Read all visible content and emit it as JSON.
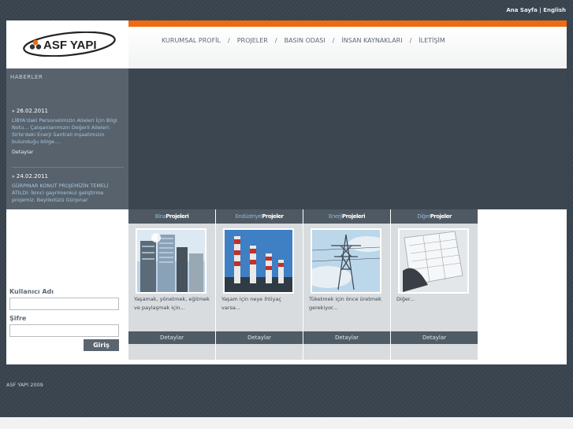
{
  "toplinks": {
    "home": "Ana Sayfa",
    "separator": "|",
    "english": "English"
  },
  "logo": {
    "text": "ASF YAPI"
  },
  "nav": {
    "items": [
      "KURUMSAL PROFİL",
      "PROJELER",
      "BASIN ODASI",
      "İNSAN KAYNAKLARI",
      "İLETİŞİM"
    ],
    "separator": "/"
  },
  "news": {
    "title": "HABERLER",
    "items": [
      {
        "date": "26.02.2011",
        "text": "LİBYA'daki Personelimizin Aileleri İçin Bilgi Notu... Çalışanlarımızın Değerli Aileleri: Sirte'deki Enerji Santrali inşaatımızın bulunduğu bölge....",
        "more": "Detaylar"
      },
      {
        "date": "24.02.2011",
        "text": "GÜRPINAR KONUT PROJEMİZİN TEMELİ ATILDI: İkinci gayrimenkul geliştirme projemiz: Beylikdüzü Gürpınar",
        "more": "Detaylar"
      }
    ]
  },
  "login": {
    "username_label": "Kullanıcı Adı",
    "username_value": "",
    "password_label": "Şifre",
    "password_value": "",
    "button": "Giriş"
  },
  "projects": [
    {
      "head_light": "Bina",
      "head_bold": "Projeleri",
      "text": "Yaşamak, yönetmek, eğitmek ve paylaşmak için...",
      "button": "Detaylar",
      "image": "buildings"
    },
    {
      "head_light": "Endüstriyel",
      "head_bold": "Projeler",
      "text": "Yaşam için neye ihtiyaç varsa...",
      "button": "Detaylar",
      "image": "chimneys"
    },
    {
      "head_light": "Enerji",
      "head_bold": "Projeleri",
      "text": "Tüketmek için önce üretmek gerekiyor...",
      "button": "Detaylar",
      "image": "power-tower"
    },
    {
      "head_light": "Diğer",
      "head_bold": "Projeler",
      "text": "Diğer...",
      "button": "Detaylar",
      "image": "blueprints"
    }
  ],
  "footer": {
    "text": "ASF YAPI 2009"
  },
  "colors": {
    "accent": "#ee6b12",
    "background": "#3c4650",
    "panel": "#57626c",
    "link": "#a8c6e0"
  }
}
